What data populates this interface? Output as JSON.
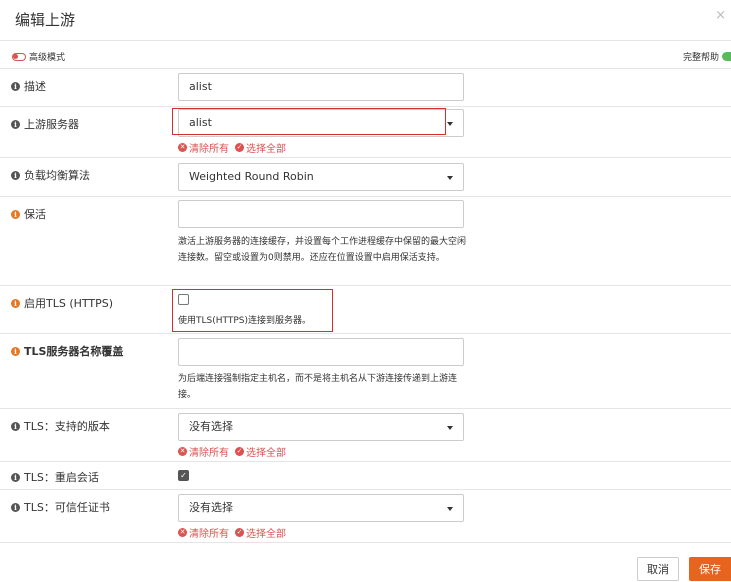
{
  "dialog": {
    "title": "编辑上游",
    "close": "×"
  },
  "toggles": {
    "advanced_mode": "高级模式",
    "full_help": "完整帮助"
  },
  "fields": {
    "description": {
      "label": "描述",
      "value": "alist"
    },
    "upstream_servers": {
      "label": "上游服务器",
      "value": "alist",
      "clear_all": "清除所有",
      "select_all": "选择全部"
    },
    "load_balancing": {
      "label": "负载均衡算法",
      "value": "Weighted Round Robin"
    },
    "keepalive": {
      "label": "保活",
      "value": "",
      "help": "激活上游服务器的连接缓存，并设置每个工作进程缓存中保留的最大空闲连接数。留空或设置为0则禁用。还应在位置设置中启用保活支持。"
    },
    "enable_tls": {
      "label": "启用TLS (HTTPS)",
      "checked": false,
      "help": "使用TLS(HTTPS)连接到服务器。"
    },
    "tls_servername": {
      "label": "TLS服务器名称覆盖",
      "value": "",
      "help": "为后端连接强制指定主机名，而不是将主机名从下游连接传递到上游连接。"
    },
    "tls_versions": {
      "label": "TLS：支持的版本",
      "value": "没有选择",
      "clear_all": "清除所有",
      "select_all": "选择全部"
    },
    "tls_session_reuse": {
      "label": "TLS：重启会话",
      "checked": true
    },
    "tls_trusted_cert": {
      "label": "TLS：可信任证书",
      "value": "没有选择",
      "clear_all": "清除所有",
      "select_all": "选择全部"
    }
  },
  "footer": {
    "cancel": "取消",
    "save": "保存"
  },
  "colors": {
    "accent": "#e6641e",
    "danger": "#d9534f",
    "success": "#5cb85c"
  }
}
